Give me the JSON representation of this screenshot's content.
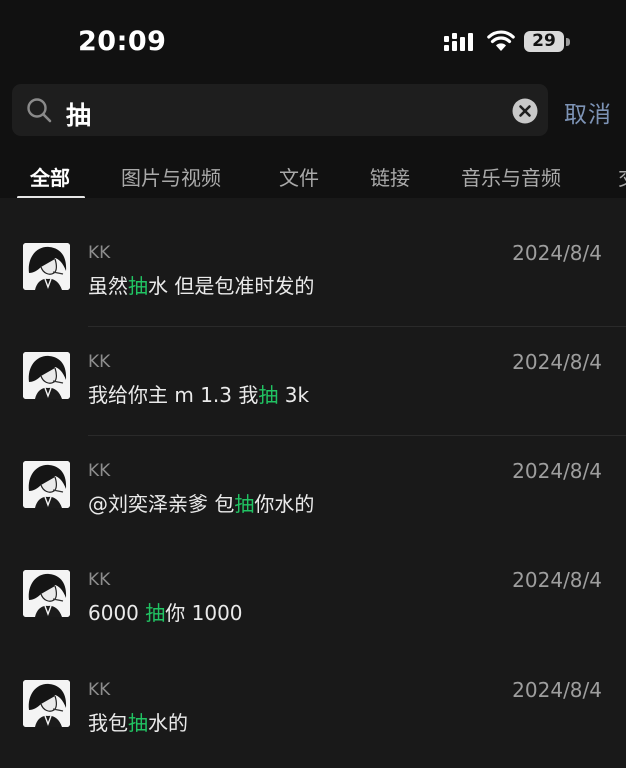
{
  "status_bar": {
    "time": "20:09",
    "battery_level": "29",
    "icons": [
      "cellular-signal-icon",
      "wifi-icon",
      "battery-icon"
    ]
  },
  "search": {
    "query": "抽",
    "cancel_label": "取消",
    "icons": [
      "search-icon",
      "clear-icon"
    ]
  },
  "tabs": [
    {
      "label": "全部",
      "active": true
    },
    {
      "label": "图片与视频",
      "active": false
    },
    {
      "label": "文件",
      "active": false
    },
    {
      "label": "链接",
      "active": false
    },
    {
      "label": "音乐与音频",
      "active": false
    },
    {
      "label": "交",
      "active": false
    }
  ],
  "results": [
    {
      "sender": "KK",
      "date": "2024/8/4",
      "before": "虽然",
      "highlight": "抽",
      "after": "水 但是包准时发的"
    },
    {
      "sender": "KK",
      "date": "2024/8/4",
      "before": "我给你主 m 1.3 我",
      "highlight": "抽",
      "after": " 3k"
    },
    {
      "sender": "KK",
      "date": "2024/8/4",
      "before": "@刘奕泽亲爹 包",
      "highlight": "抽",
      "after": "你水的"
    },
    {
      "sender": "KK",
      "date": "2024/8/4",
      "before": "6000 ",
      "highlight": "抽",
      "after": "你 1000"
    },
    {
      "sender": "KK",
      "date": "2024/8/4",
      "before": "我包",
      "highlight": "抽",
      "after": "水的"
    }
  ],
  "colors": {
    "background": "#111111",
    "list_background": "#191919",
    "highlight": "#21c463",
    "cancel": "#7d93b5"
  }
}
